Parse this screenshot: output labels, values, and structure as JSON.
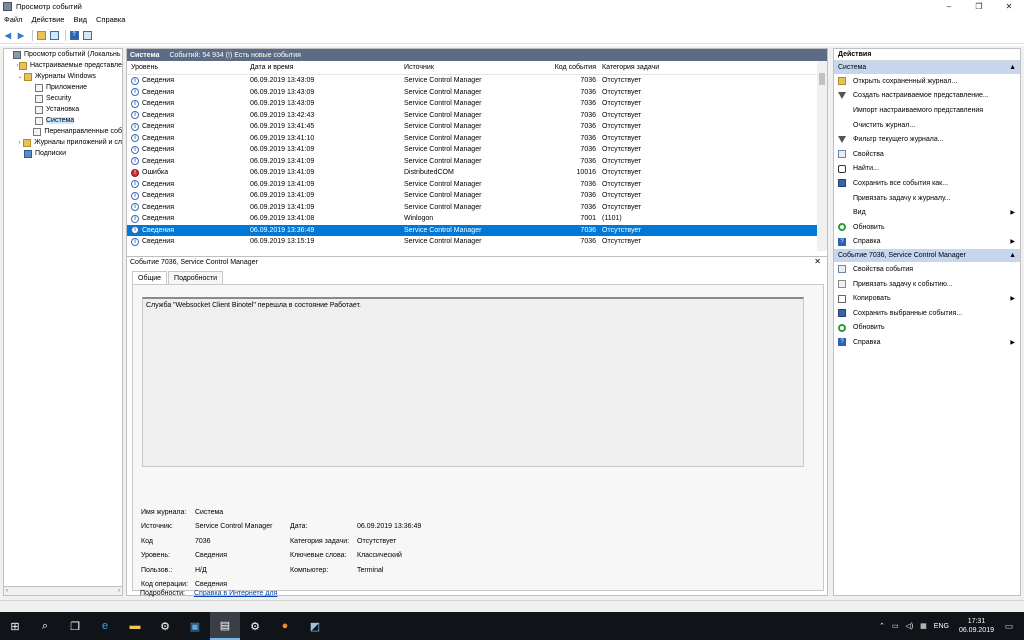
{
  "window": {
    "title": "Просмотр событий",
    "minimize": "–",
    "maximize": "❐",
    "close": "✕"
  },
  "menu": [
    "Файл",
    "Действие",
    "Вид",
    "Справка"
  ],
  "tree": [
    {
      "label": "Просмотр событий (Локальнь",
      "indent": 0,
      "icon": "computer-icon",
      "exp": ""
    },
    {
      "label": "Настраиваемые представле",
      "indent": 1,
      "icon": "folder-icon",
      "exp": "›"
    },
    {
      "label": "Журналы Windows",
      "indent": 1,
      "icon": "folder-icon",
      "exp": "⌄"
    },
    {
      "label": "Приложение",
      "indent": 2,
      "icon": "log-icon",
      "exp": ""
    },
    {
      "label": "Security",
      "indent": 2,
      "icon": "log-icon",
      "exp": ""
    },
    {
      "label": "Установка",
      "indent": 2,
      "icon": "log-icon",
      "exp": ""
    },
    {
      "label": "Система",
      "indent": 2,
      "icon": "log-icon",
      "exp": "",
      "selected": true
    },
    {
      "label": "Перенаправленные соб",
      "indent": 2,
      "icon": "log-icon",
      "exp": ""
    },
    {
      "label": "Журналы приложений и сл",
      "indent": 1,
      "icon": "folder-icon",
      "exp": "›"
    },
    {
      "label": "Подписки",
      "indent": 1,
      "icon": "subscription-icon",
      "exp": ""
    }
  ],
  "center": {
    "title": "Система",
    "subtitle": "Событий: 54 934 (!) Есть новые события",
    "columns": [
      "Уровень",
      "Дата и время",
      "Источник",
      "Код события",
      "Категория задачи"
    ],
    "rows": [
      [
        "Сведения",
        "06.09.2019 13:43:09",
        "Service Control Manager",
        "7036",
        "Отсутствует"
      ],
      [
        "Сведения",
        "06.09.2019 13:43:09",
        "Service Control Manager",
        "7036",
        "Отсутствует"
      ],
      [
        "Сведения",
        "06.09.2019 13:43:09",
        "Service Control Manager",
        "7036",
        "Отсутствует"
      ],
      [
        "Сведения",
        "06.09.2019 13:42:43",
        "Service Control Manager",
        "7036",
        "Отсутствует"
      ],
      [
        "Сведения",
        "06.09.2019 13:41:45",
        "Service Control Manager",
        "7036",
        "Отсутствует"
      ],
      [
        "Сведения",
        "06.09.2019 13:41:10",
        "Service Control Manager",
        "7036",
        "Отсутствует"
      ],
      [
        "Сведения",
        "06.09.2019 13:41:09",
        "Service Control Manager",
        "7036",
        "Отсутствует"
      ],
      [
        "Сведения",
        "06.09.2019 13:41:09",
        "Service Control Manager",
        "7036",
        "Отсутствует"
      ],
      [
        "Ошибка",
        "06.09.2019 13:41:09",
        "DistributedCOM",
        "10016",
        "Отсутствует"
      ],
      [
        "Сведения",
        "06.09.2019 13:41:09",
        "Service Control Manager",
        "7036",
        "Отсутствует"
      ],
      [
        "Сведения",
        "06.09.2019 13:41:09",
        "Service Control Manager",
        "7036",
        "Отсутствует"
      ],
      [
        "Сведения",
        "06.09.2019 13:41:09",
        "Service Control Manager",
        "7036",
        "Отсутствует"
      ],
      [
        "Сведения",
        "06.09.2019 13:41:08",
        "Winlogon",
        "7001",
        "(1101)"
      ],
      [
        "Сведения",
        "06.09.2019 13:36:49",
        "Service Control Manager",
        "7036",
        "Отсутствует"
      ],
      [
        "Сведения",
        "06.09.2019 13:15:19",
        "Service Control Manager",
        "7036",
        "Отсутствует"
      ]
    ],
    "selected_row": 13
  },
  "detail": {
    "title": "Событие 7036, Service Control Manager",
    "close": "✕",
    "tabs": [
      "Общие",
      "Подробности"
    ],
    "message": "Служба \"Websocket Client Binotel\" перешла в состояние Работает.",
    "labels": {
      "log": "Имя журнала:",
      "source": "Источник:",
      "code": "Код",
      "level": "Уровень:",
      "user": "Пользов.:",
      "opcode": "Код операции:",
      "more": "Подробности:",
      "date": "Дата:",
      "category": "Категория задачи:",
      "keywords": "Ключевые слова:",
      "computer": "Компьютер:"
    },
    "values": {
      "log": "Система",
      "source": "Service Control Manager",
      "code": "7036",
      "level": "Сведения",
      "user": "Н/Д",
      "opcode": "Сведения",
      "more": "Справка в Интернете для",
      "date": "06.09.2019 13:36:49",
      "category": "Отсутствует",
      "keywords": "Классический",
      "computer": "Terminal"
    }
  },
  "actions": {
    "title": "Действия",
    "section1": "Система",
    "items1": [
      {
        "label": "Открыть сохраненный журнал...",
        "icon": "open-log-icon",
        "cls": "ai-open"
      },
      {
        "label": "Создать настраиваемое представление...",
        "icon": "create-view-icon",
        "cls": "ai-filter"
      },
      {
        "label": "Импорт настраиваемого представления",
        "icon": "import-icon",
        "cls": "ai-blank"
      },
      {
        "label": "Очистить журнал...",
        "icon": "clear-icon",
        "cls": "ai-blank"
      },
      {
        "label": "Фильтр текущего журнала...",
        "icon": "filter-icon",
        "cls": "ai-filter"
      },
      {
        "label": "Свойства",
        "icon": "properties-icon",
        "cls": "ai-props"
      },
      {
        "label": "Найти...",
        "icon": "find-icon",
        "cls": "ai-find"
      },
      {
        "label": "Сохранить все события как...",
        "icon": "save-icon",
        "cls": "ai-save"
      },
      {
        "label": "Привязать задачу к журналу...",
        "icon": "attach-task-icon",
        "cls": "ai-blank"
      },
      {
        "label": "Вид",
        "icon": "view-icon",
        "cls": "ai-blank",
        "arrow": true
      },
      {
        "label": "Обновить",
        "icon": "refresh-icon",
        "cls": "ai-refresh"
      },
      {
        "label": "Справка",
        "icon": "help-icon",
        "cls": "ai-help",
        "arrow": true
      }
    ],
    "section2": "Событие 7036, Service Control Manager",
    "items2": [
      {
        "label": "Свойства события",
        "icon": "event-properties-icon",
        "cls": "ai-props"
      },
      {
        "label": "Привязать задачу к событию...",
        "icon": "attach-task-icon",
        "cls": "ai-task"
      },
      {
        "label": "Копировать",
        "icon": "copy-icon",
        "cls": "ai-copy",
        "arrow": true
      },
      {
        "label": "Сохранить выбранные события...",
        "icon": "save-icon",
        "cls": "ai-save"
      },
      {
        "label": "Обновить",
        "icon": "refresh-icon",
        "cls": "ai-refresh"
      },
      {
        "label": "Справка",
        "icon": "help-icon",
        "cls": "ai-help",
        "arrow": true
      }
    ]
  },
  "tray": {
    "lang": "ENG",
    "time": "17:31",
    "date": "06.09.2019"
  }
}
